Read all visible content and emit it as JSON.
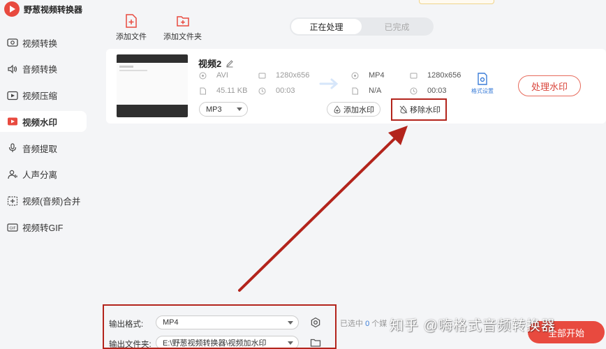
{
  "app": {
    "name": "野葱视频转换器"
  },
  "sidebar": {
    "items": [
      {
        "label": "视频转换",
        "icon": "video-convert-icon"
      },
      {
        "label": "音频转换",
        "icon": "audio-convert-icon"
      },
      {
        "label": "视频压缩",
        "icon": "video-compress-icon"
      },
      {
        "label": "视频水印",
        "icon": "video-watermark-icon",
        "active": true
      },
      {
        "label": "音频提取",
        "icon": "audio-extract-icon"
      },
      {
        "label": "人声分离",
        "icon": "voice-separate-icon"
      },
      {
        "label": "视频(音频)合并",
        "icon": "merge-icon"
      },
      {
        "label": "视频转GIF",
        "icon": "gif-icon"
      }
    ]
  },
  "toolbar": {
    "add_file": "添加文件",
    "add_folder": "添加文件夹"
  },
  "tabs": [
    {
      "label": "正在处理",
      "active": true
    },
    {
      "label": "已完成",
      "active": false
    }
  ],
  "file": {
    "name": "视频2",
    "source": {
      "format": "AVI",
      "resolution": "1280x656",
      "size": "45.11 KB",
      "duration": "00:03"
    },
    "target": {
      "format": "MP4",
      "resolution": "1280x656",
      "size": "N/A",
      "duration": "00:03"
    },
    "audio_format": "MP3",
    "add_watermark": "添加水印",
    "remove_watermark": "移除水印",
    "format_settings": "格式设置",
    "process": "处理水印"
  },
  "bottom": {
    "output_format_label": "输出格式:",
    "output_format_value": "MP4",
    "output_folder_label": "输出文件夹:",
    "output_folder_value": "E:\\野葱视频转换器\\视频加水印",
    "selected_prefix": "已选中",
    "selected_count": "0",
    "selected_suffix": "个媒",
    "start_all": "全部开始"
  },
  "overlay_watermark": "知乎 @嗨格式音频转换器",
  "colors": {
    "accent": "#e84a3f",
    "annotation": "#b3241c",
    "link": "#3b7dd8"
  }
}
